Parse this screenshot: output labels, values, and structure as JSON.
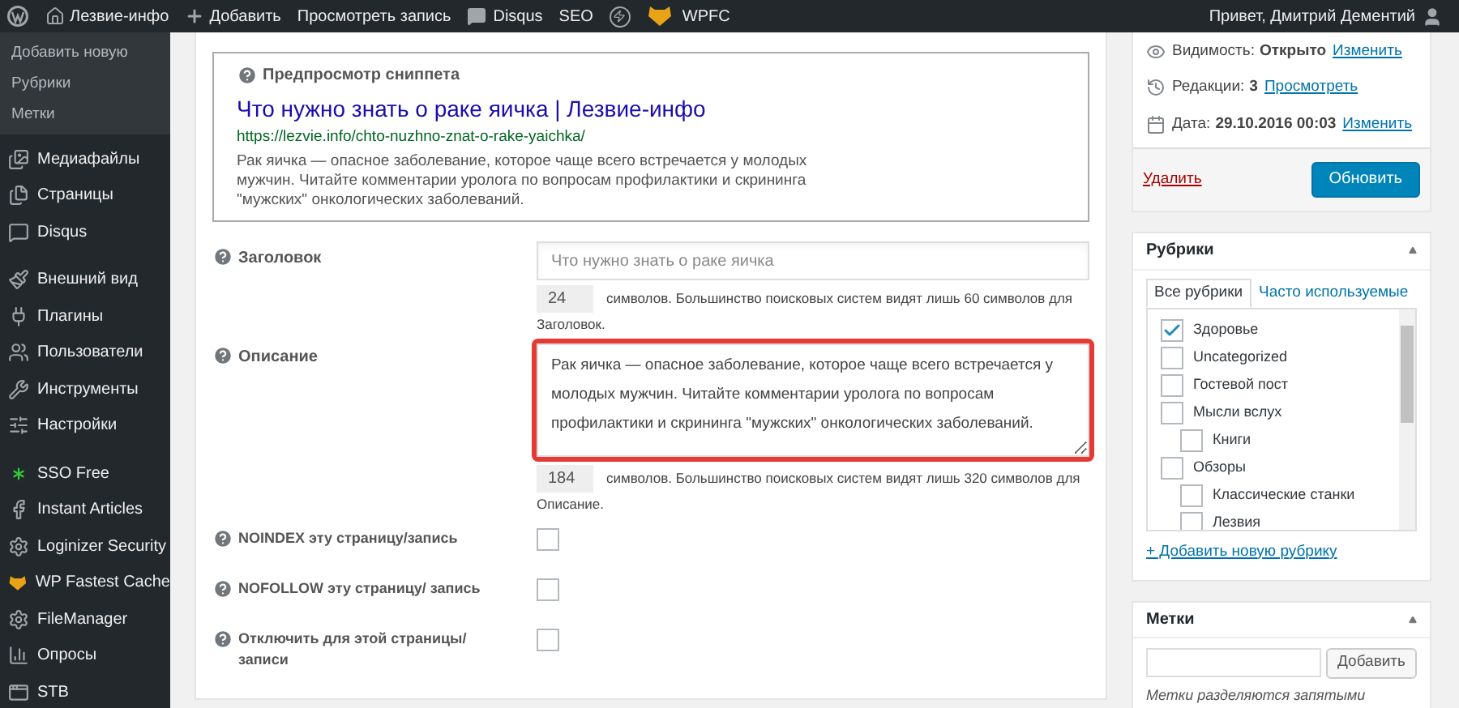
{
  "admin_bar": {
    "site": "Лезвие-инфо",
    "add": "Добавить",
    "view": "Просмотреть запись",
    "disqus": "Disqus",
    "seo": "SEO",
    "wpfc": "WPFC",
    "greeting": "Привет, Дмитрий Дементий"
  },
  "sidebar": {
    "submenu": [
      {
        "label": "Добавить новую"
      },
      {
        "label": "Рубрики"
      },
      {
        "label": "Метки"
      }
    ],
    "items": [
      {
        "label": "Медиафайлы"
      },
      {
        "label": "Страницы"
      },
      {
        "label": "Disqus"
      },
      {
        "label": "Внешний вид"
      },
      {
        "label": "Плагины"
      },
      {
        "label": "Пользователи"
      },
      {
        "label": "Инструменты"
      },
      {
        "label": "Настройки"
      },
      {
        "label": "SSO Free"
      },
      {
        "label": "Instant Articles"
      },
      {
        "label": "Loginizer Security"
      },
      {
        "label": "WP Fastest Cache"
      },
      {
        "label": "FileManager"
      },
      {
        "label": "Опросы"
      },
      {
        "label": "STB"
      }
    ]
  },
  "seo": {
    "preview": {
      "heading": "Предпросмотр сниппета",
      "title": "Что нужно знать о раке яичка | Лезвие-инфо",
      "url": "https://lezvie.info/chto-nuzhno-znat-o-rake-yaichka/",
      "description": "Рак яичка — опасное заболевание, которое чаще всего встречается у молодых мужчин. Читайте комментарии уролога по вопросам профилактики и скрининга \"мужских\" онкологических заболеваний."
    },
    "title_field": {
      "label": "Заголовок",
      "placeholder": "Что нужно знать о раке яичка",
      "count": "24",
      "hint": "символов. Большинство поисковых систем видят лишь 60 символов для Заголовок."
    },
    "description_field": {
      "label": "Описание",
      "value": "Рак яичка — опасное заболевание, которое чаще всего встречается у молодых мужчин. Читайте комментарии уролога по вопросам профилактики и скрининга \"мужских\" онкологических заболеваний.",
      "count": "184",
      "hint": "символов. Большинство поисковых систем видят лишь 320 символов для Описание.",
      "highlighted": true
    },
    "options": [
      {
        "label": "NOINDEX эту страницу/запись",
        "checked": false
      },
      {
        "label": "NOFOLLOW эту страницу/ запись",
        "checked": false
      },
      {
        "label": "Отключить для этой страницы/ записи",
        "checked": false
      }
    ]
  },
  "publish": {
    "rows": [
      {
        "label": "Видимость:",
        "value": "Открыто",
        "link": "Изменить"
      },
      {
        "label": "Редакции:",
        "value": "3",
        "link": "Просмотреть"
      },
      {
        "label": "Дата:",
        "value": "29.10.2016 00:03",
        "link": "Изменить"
      }
    ],
    "delete": "Удалить",
    "update": "Обновить"
  },
  "categories": {
    "title": "Рубрики",
    "tabs": [
      {
        "label": "Все рубрики",
        "selected": true
      },
      {
        "label": "Часто используемые",
        "selected": false
      }
    ],
    "items": [
      {
        "label": "Здоровье",
        "checked": true
      },
      {
        "label": "Uncategorized",
        "checked": false
      },
      {
        "label": "Гостевой пост",
        "checked": false
      },
      {
        "label": "Мысли вслух",
        "checked": false,
        "children": [
          {
            "label": "Книги",
            "checked": false
          }
        ]
      },
      {
        "label": "Обзоры",
        "checked": false,
        "children": [
          {
            "label": "Классические станки",
            "checked": false
          },
          {
            "label": "Лезвия",
            "checked": false
          }
        ]
      }
    ],
    "add_link": "+ Добавить новую рубрику"
  },
  "tags": {
    "title": "Метки",
    "button": "Добавить",
    "note": "Метки разделяются запятыми"
  }
}
